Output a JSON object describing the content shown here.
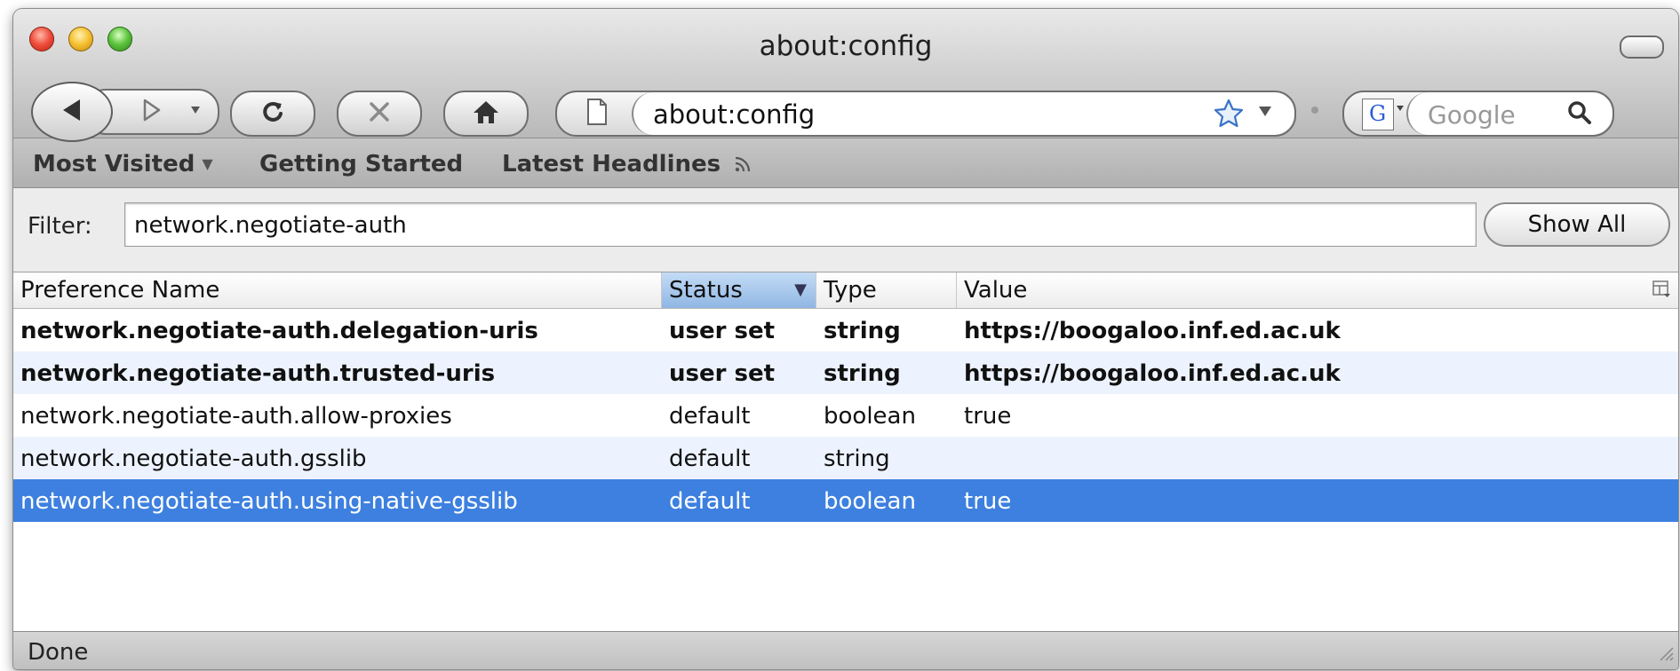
{
  "window": {
    "title": "about:config"
  },
  "toolbar": {
    "back_icon": "back-arrow-icon",
    "forward_icon": "forward-arrow-icon",
    "reload_icon": "reload-icon",
    "stop_icon": "stop-icon",
    "home_icon": "home-icon",
    "url": "about:config",
    "search_placeholder": "Google"
  },
  "bookmarks": [
    {
      "label": "Most Visited",
      "has_dropdown": true
    },
    {
      "label": "Getting Started"
    },
    {
      "label": "Latest Headlines",
      "has_feed_icon": true
    }
  ],
  "filter": {
    "label": "Filter:",
    "value": "network.negotiate-auth",
    "show_all_label": "Show All"
  },
  "table": {
    "columns": [
      "Preference Name",
      "Status",
      "Type",
      "Value"
    ],
    "sorted_column": "Status",
    "rows": [
      {
        "name": "network.negotiate-auth.delegation-uris",
        "status": "user set",
        "type": "string",
        "value": "https://boogaloo.inf.ed.ac.uk",
        "bold": true,
        "selected": false
      },
      {
        "name": "network.negotiate-auth.trusted-uris",
        "status": "user set",
        "type": "string",
        "value": "https://boogaloo.inf.ed.ac.uk",
        "bold": true,
        "selected": false
      },
      {
        "name": "network.negotiate-auth.allow-proxies",
        "status": "default",
        "type": "boolean",
        "value": "true",
        "bold": false,
        "selected": false
      },
      {
        "name": "network.negotiate-auth.gsslib",
        "status": "default",
        "type": "string",
        "value": "",
        "bold": false,
        "selected": false
      },
      {
        "name": "network.negotiate-auth.using-native-gsslib",
        "status": "default",
        "type": "boolean",
        "value": "true",
        "bold": false,
        "selected": true
      }
    ]
  },
  "statusbar": {
    "text": "Done"
  },
  "colors": {
    "selection": "#3d80df",
    "alt_row": "#edf3fe"
  }
}
